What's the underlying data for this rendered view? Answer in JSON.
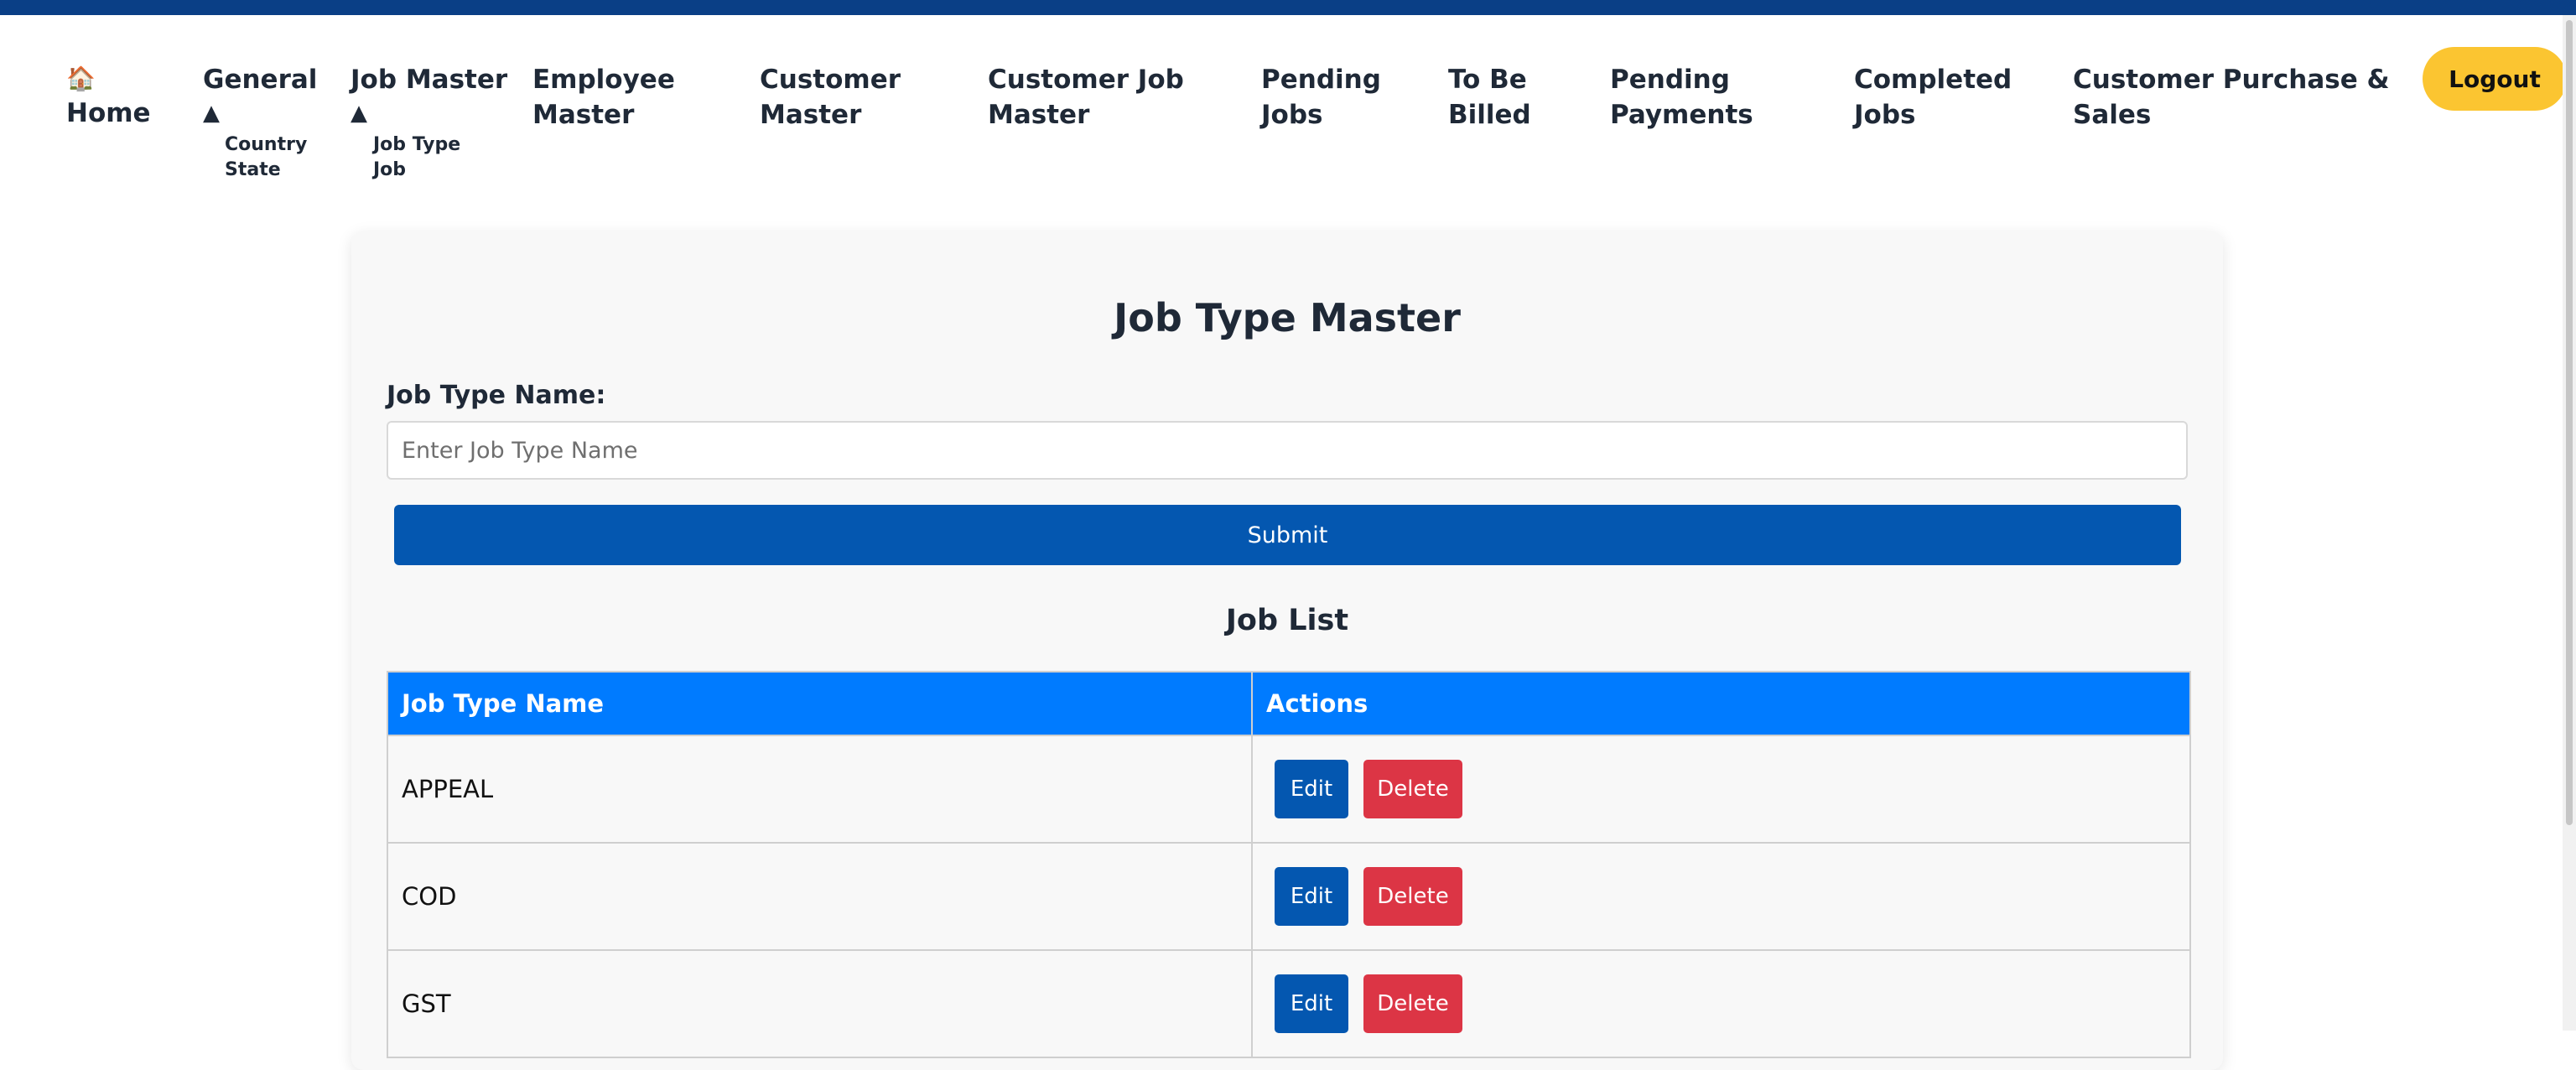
{
  "nav": {
    "home_icon": "🏠",
    "home_label": "Home",
    "general_label": "General",
    "general_caret": "▲",
    "general_submenu": [
      "Country",
      "State"
    ],
    "job_master_label": "Job Master",
    "job_master_caret": "▲",
    "job_master_submenu": [
      "Job Type",
      "Job"
    ],
    "employee_master_line1": "Employee",
    "employee_master_line2": "Master",
    "customer_master_line1": "Customer",
    "customer_master_line2": "Master",
    "customer_job_master_line1": "Customer Job",
    "customer_job_master_line2": "Master",
    "pending_jobs_line1": "Pending",
    "pending_jobs_line2": "Jobs",
    "to_be_billed_line1": "To Be",
    "to_be_billed_line2": "Billed",
    "pending_payments_line1": "Pending",
    "pending_payments_line2": "Payments",
    "completed_jobs_line1": "Completed",
    "completed_jobs_line2": "Jobs",
    "customer_purchase_line1": "Customer Purchase &",
    "customer_purchase_line2": "Sales",
    "logout_label": "Logout"
  },
  "form": {
    "title": "Job Type Master",
    "field_label": "Job Type Name:",
    "placeholder": "Enter Job Type Name",
    "value": "",
    "submit_label": "Submit"
  },
  "list": {
    "title": "Job List",
    "columns": [
      "Job Type Name",
      "Actions"
    ],
    "rows": [
      {
        "name": "APPEAL",
        "edit": "Edit",
        "delete": "Delete"
      },
      {
        "name": "COD",
        "edit": "Edit",
        "delete": "Delete"
      },
      {
        "name": "GST",
        "edit": "Edit",
        "delete": "Delete"
      }
    ]
  },
  "colors": {
    "top_bar": "#0a3f86",
    "primary_button": "#0457b0",
    "table_header": "#007bff",
    "delete_button": "#dc3545",
    "logout_button": "#fbc531"
  },
  "icons": {
    "home": "home-icon",
    "caret": "caret-up-icon"
  }
}
